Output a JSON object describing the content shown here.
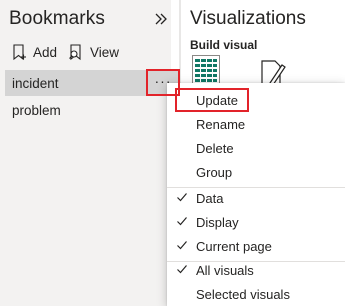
{
  "bookmarks": {
    "title": "Bookmarks",
    "toolbar": {
      "add_label": "Add",
      "view_label": "View"
    },
    "items": [
      {
        "label": "incident"
      },
      {
        "label": "problem"
      }
    ],
    "more_label": "···"
  },
  "visualizations": {
    "title": "Visualizations",
    "build_label": "Build visual"
  },
  "context_menu": {
    "items": [
      {
        "label": "Update"
      },
      {
        "label": "Rename"
      },
      {
        "label": "Delete"
      },
      {
        "label": "Group"
      },
      {
        "label": "Data",
        "checked": true
      },
      {
        "label": "Display",
        "checked": true
      },
      {
        "label": "Current page",
        "checked": true
      },
      {
        "label": "All visuals",
        "checked": true
      },
      {
        "label": "Selected visuals",
        "checked": false
      }
    ]
  },
  "colors": {
    "highlight_border": "#e2232a",
    "pane_background": "#f3f2f1",
    "selected_item": "#d4d4d4",
    "build_icon": "#117865"
  }
}
